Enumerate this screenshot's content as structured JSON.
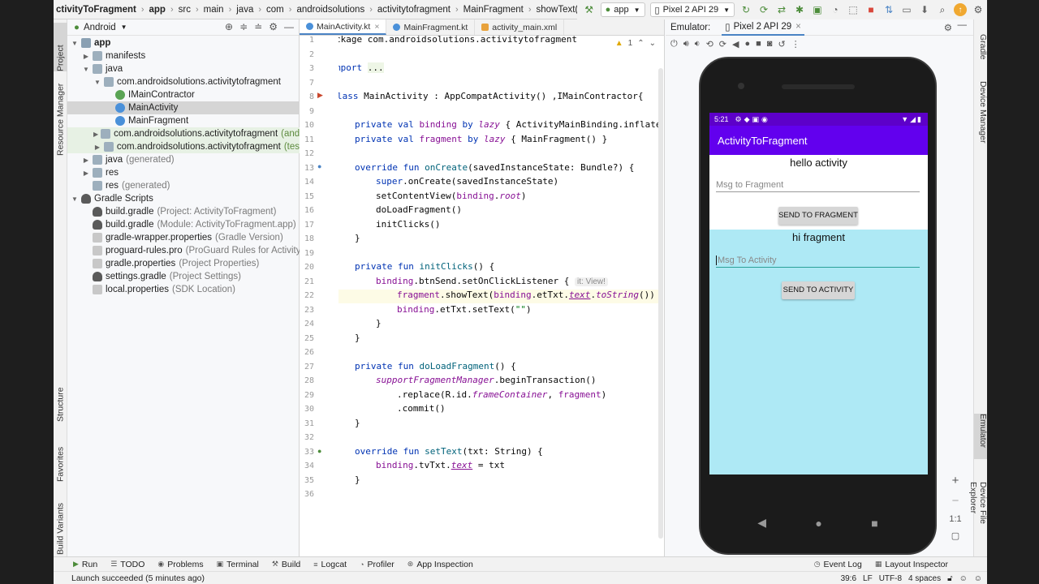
{
  "breadcrumbs": [
    "ctivityToFragment",
    "app",
    "src",
    "main",
    "java",
    "com",
    "androidsolutions",
    "activitytofragment",
    "MainFragment",
    "showText(msg: String)"
  ],
  "toolbar": {
    "run_config": "app",
    "device": "Pixel 2 API 29"
  },
  "left_tool_tabs": [
    "Project",
    "Resource Manager",
    "Structure",
    "Favorites",
    "Build Variants"
  ],
  "right_tool_tabs": [
    "Gradle",
    "Device Manager",
    "Emulator",
    "Device File Explorer"
  ],
  "project": {
    "view_mode": "Android",
    "tree": [
      {
        "label": "app",
        "extra": "",
        "bold": true
      },
      {
        "label": "manifests",
        "extra": ""
      },
      {
        "label": "java",
        "extra": ""
      },
      {
        "label": "com.androidsolutions.activitytofragment",
        "extra": ""
      },
      {
        "label": "IMainContractor",
        "extra": ""
      },
      {
        "label": "MainActivity",
        "extra": ""
      },
      {
        "label": "MainFragment",
        "extra": ""
      },
      {
        "label": "com.androidsolutions.activitytofragment",
        "extra": "(and"
      },
      {
        "label": "com.androidsolutions.activitytofragment",
        "extra": "(tes"
      },
      {
        "label": "java",
        "extra": "(generated)"
      },
      {
        "label": "res",
        "extra": ""
      },
      {
        "label": "res",
        "extra": "(generated)"
      },
      {
        "label": "Gradle Scripts",
        "extra": ""
      },
      {
        "label": "build.gradle",
        "extra": "(Project: ActivityToFragment)"
      },
      {
        "label": "build.gradle",
        "extra": "(Module: ActivityToFragment.app)"
      },
      {
        "label": "gradle-wrapper.properties",
        "extra": "(Gradle Version)"
      },
      {
        "label": "proguard-rules.pro",
        "extra": "(ProGuard Rules for ActivityT"
      },
      {
        "label": "gradle.properties",
        "extra": "(Project Properties)"
      },
      {
        "label": "settings.gradle",
        "extra": "(Project Settings)"
      },
      {
        "label": "local.properties",
        "extra": "(SDK Location)"
      }
    ]
  },
  "editor": {
    "tabs": [
      "MainActivity.kt",
      "MainFragment.kt",
      "activity_main.xml"
    ],
    "warning_count": "1",
    "line_numbers": [
      "1",
      "2",
      "3",
      "7",
      "8",
      "9",
      "10",
      "11",
      "12",
      "13",
      "14",
      "15",
      "16",
      "17",
      "18",
      "19",
      "20",
      "21",
      "22",
      "23",
      "24",
      "25",
      "26",
      "27",
      "28",
      "29",
      "30",
      "31",
      "32",
      "33",
      "34",
      "35",
      "36"
    ],
    "inlay_hint": "it: View!"
  },
  "emulator": {
    "title": "Emulator:",
    "device_tab": "Pixel 2 API 29",
    "status_time": "5:21",
    "app_title": "ActivityToFragment",
    "activity_text": "hello activity",
    "fragment_field_hint": "Msg to Fragment",
    "send_fragment_label": "SEND TO FRAGMENT",
    "fragment_text": "hi fragment",
    "activity_field_hint": "Msg To Activity",
    "send_activity_label": "SEND TO ACTIVITY",
    "zoom_label": "1:1"
  },
  "bottom_tabs": [
    "Run",
    "TODO",
    "Problems",
    "Terminal",
    "Build",
    "Logcat",
    "Profiler",
    "App Inspection"
  ],
  "bottom_right_tabs": [
    "Event Log",
    "Layout Inspector"
  ],
  "status": {
    "message": "Launch succeeded (5 minutes ago)",
    "position": "39:6",
    "line_sep": "LF",
    "encoding": "UTF-8",
    "indent": "4 spaces"
  }
}
